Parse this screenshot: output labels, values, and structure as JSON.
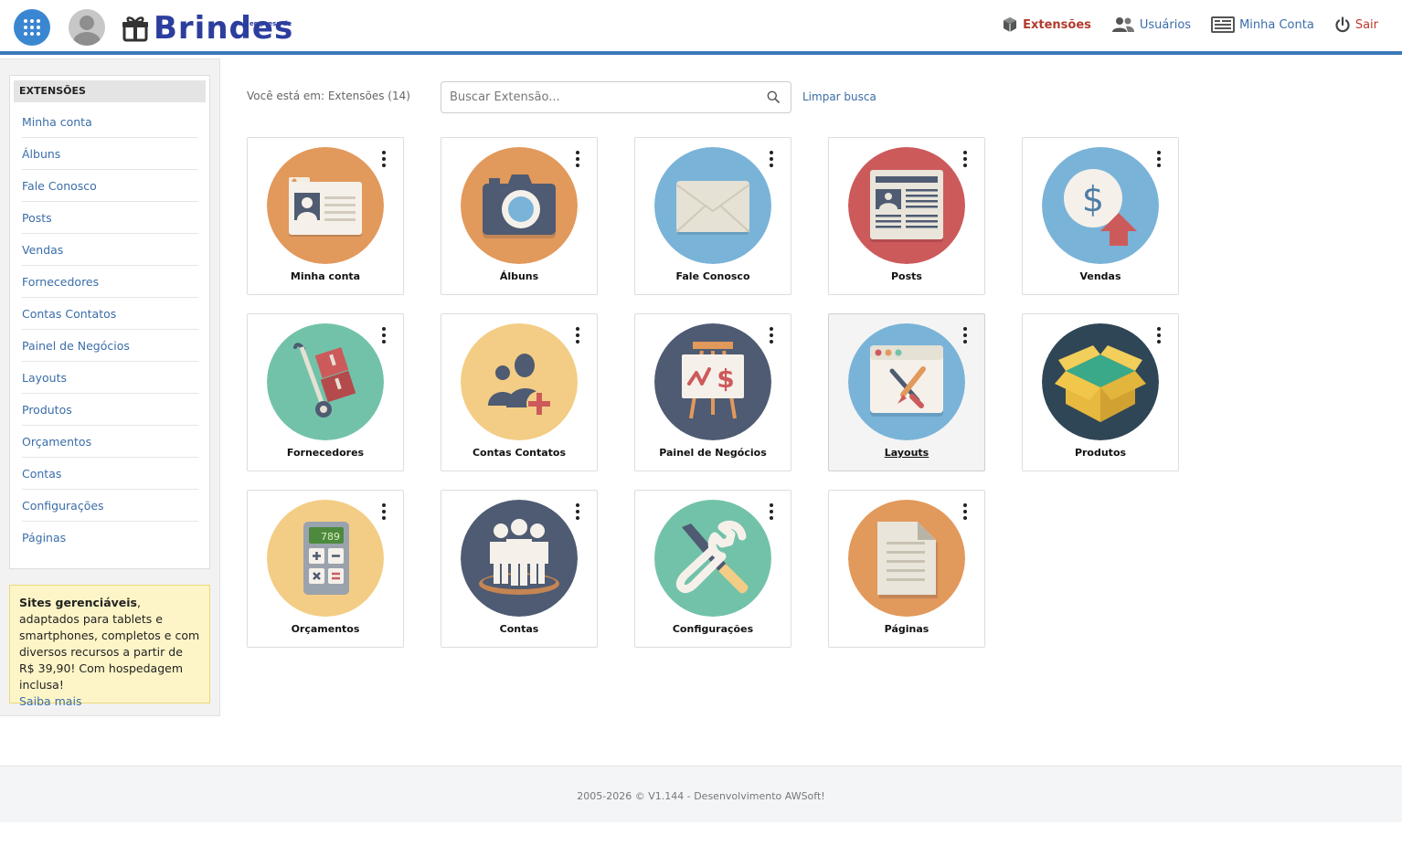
{
  "header": {
    "logo_text": "Brindes",
    "logo_tagline": "sua empresa de",
    "nav": [
      {
        "label": "Extensões",
        "icon": "cube-icon"
      },
      {
        "label": "Usuários",
        "icon": "users-icon"
      },
      {
        "label": "Minha Conta",
        "icon": "account-icon"
      },
      {
        "label": "Sair",
        "icon": "power-icon"
      }
    ]
  },
  "sidebar": {
    "title": "EXTENSÕES",
    "items": [
      "Minha conta",
      "Álbuns",
      "Fale Conosco",
      "Posts",
      "Vendas",
      "Fornecedores",
      "Contas Contatos",
      "Painel de Negócios",
      "Layouts",
      "Produtos",
      "Orçamentos",
      "Contas",
      "Configurações",
      "Páginas"
    ],
    "promo": {
      "bold": "Sites gerenciáveis",
      "text": ", adaptados para tablets e smartphones, completos e com diversos recursos a partir de R$ 39,90! Com hospedagem inclusa!",
      "link": "Saiba mais"
    }
  },
  "main": {
    "breadcrumb": "Você está em: Extensões (14)",
    "search_placeholder": "Buscar Extensão...",
    "clear_label": "Limpar busca",
    "cards": [
      {
        "label": "Minha conta",
        "icon": "id-card-icon",
        "color": "#e2995c"
      },
      {
        "label": "Álbuns",
        "icon": "camera-icon",
        "color": "#e2995c"
      },
      {
        "label": "Fale Conosco",
        "icon": "envelope-icon",
        "color": "#7ab3d8"
      },
      {
        "label": "Posts",
        "icon": "newspaper-icon",
        "color": "#cd5a5b"
      },
      {
        "label": "Vendas",
        "icon": "dollar-arrow-icon",
        "color": "#7ab3d8"
      },
      {
        "label": "Fornecedores",
        "icon": "hand-truck-icon",
        "color": "#72c2a9"
      },
      {
        "label": "Contas Contatos",
        "icon": "add-contact-icon",
        "color": "#f3cd85"
      },
      {
        "label": "Painel de Negócios",
        "icon": "easel-chart-icon",
        "color": "#4e5b72"
      },
      {
        "label": "Layouts",
        "icon": "design-window-icon",
        "color": "#7ab3d8"
      },
      {
        "label": "Produtos",
        "icon": "open-box-icon",
        "color": "#2f4656"
      },
      {
        "label": "Orçamentos",
        "icon": "calculator-icon",
        "color": "#f3cd85"
      },
      {
        "label": "Contas",
        "icon": "team-icon",
        "color": "#4e5b72"
      },
      {
        "label": "Configurações",
        "icon": "tools-icon",
        "color": "#72c2a9"
      },
      {
        "label": "Páginas",
        "icon": "document-icon",
        "color": "#e2995c"
      }
    ],
    "calculator_display": "789"
  },
  "footer": {
    "text": "2005-2026 © V1.144 - Desenvolvimento AWSoft!"
  }
}
